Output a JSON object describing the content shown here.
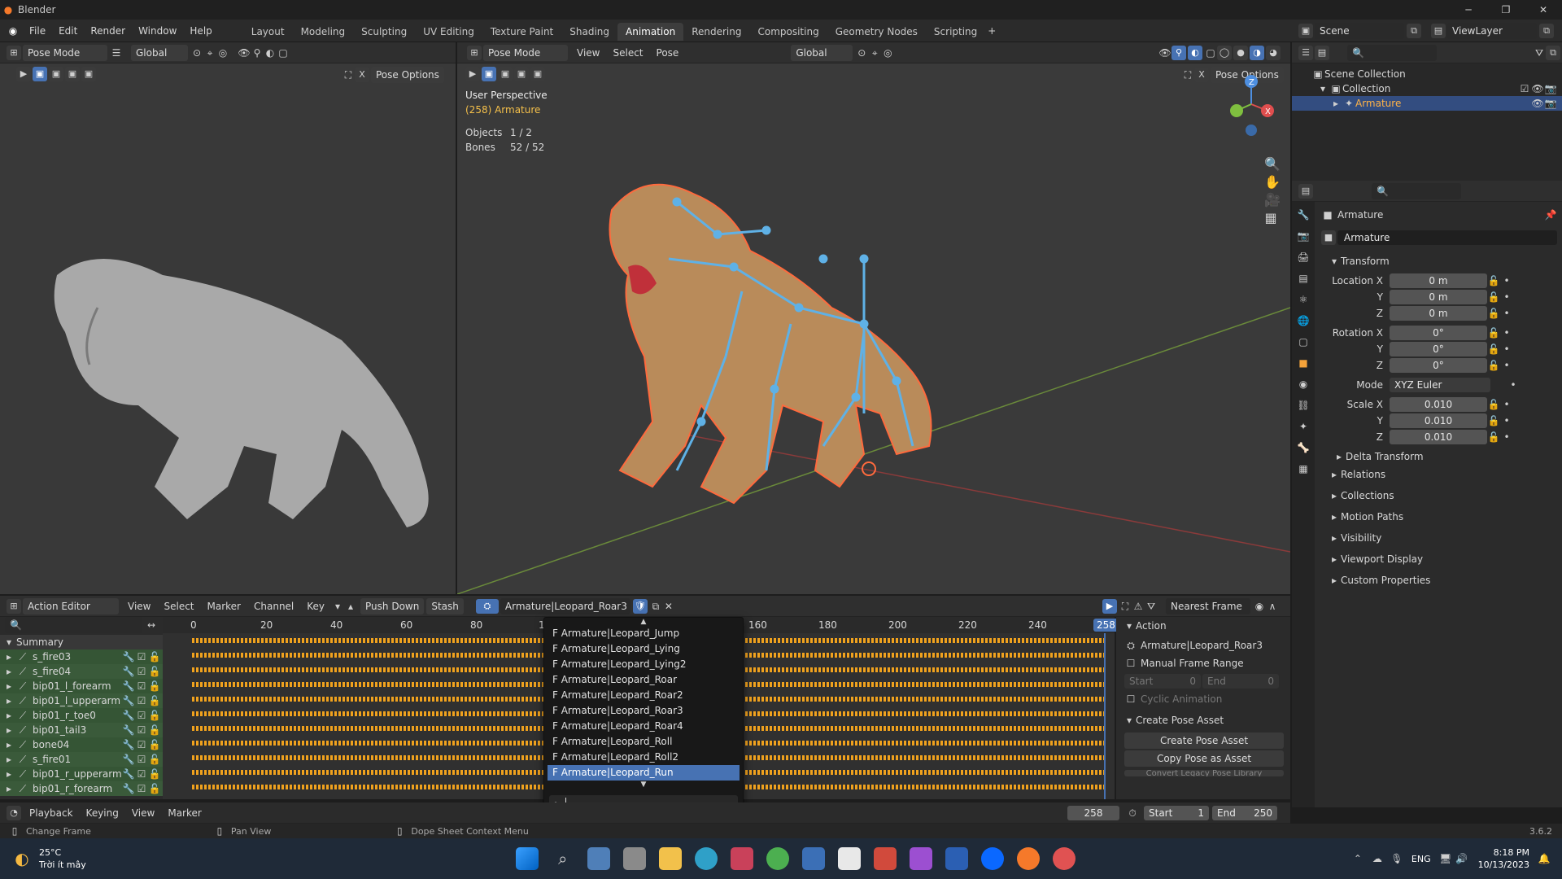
{
  "app": {
    "title": "Blender",
    "version": "3.6.2"
  },
  "menu": [
    "File",
    "Edit",
    "Render",
    "Window",
    "Help"
  ],
  "workspaces": [
    "Layout",
    "Modeling",
    "Sculpting",
    "UV Editing",
    "Texture Paint",
    "Shading",
    "Animation",
    "Rendering",
    "Compositing",
    "Geometry Nodes",
    "Scripting"
  ],
  "active_workspace": "Animation",
  "scene": {
    "name": "Scene",
    "view_layer": "ViewLayer"
  },
  "left_view": {
    "mode": "Pose Mode",
    "orientation": "Global",
    "pose_options": "Pose Options"
  },
  "main_view": {
    "mode": "Pose Mode",
    "menus": [
      "View",
      "Select",
      "Pose"
    ],
    "orientation": "Global",
    "pose_options": "Pose Options",
    "overlay": {
      "title": "User Perspective",
      "subtitle": "(258) Armature",
      "objects_label": "Objects",
      "objects_value": "1 / 2",
      "bones_label": "Bones",
      "bones_value": "52 / 52"
    },
    "gizmo": {
      "z": "Z",
      "x": "X",
      "y": "Y"
    }
  },
  "outliner": {
    "scene_collection": "Scene Collection",
    "collection": "Collection",
    "armature": "Armature"
  },
  "properties": {
    "object_name": "Armature",
    "data_name": "Armature",
    "transform_label": "Transform",
    "location_label": "Location X",
    "loc": [
      "0 m",
      "0 m",
      "0 m"
    ],
    "rotation_label": "Rotation X",
    "rot": [
      "0°",
      "0°",
      "0°"
    ],
    "mode_label": "Mode",
    "mode_value": "XYZ Euler",
    "scale_label": "Scale X",
    "scale": [
      "0.010",
      "0.010",
      "0.010"
    ],
    "axis_y": "Y",
    "axis_z": "Z",
    "sections": [
      "Delta Transform",
      "Relations",
      "Collections",
      "Motion Paths",
      "Visibility",
      "Viewport Display",
      "Custom Properties"
    ]
  },
  "action_editor": {
    "editor": "Action Editor",
    "menus": [
      "View",
      "Select",
      "Marker",
      "Channel",
      "Key"
    ],
    "push_down": "Push Down",
    "stash": "Stash",
    "action_name": "Armature|Leopard_Roar3",
    "snapping": "Nearest Frame",
    "ruler": [
      "0",
      "20",
      "40",
      "60",
      "80",
      "1",
      "160",
      "180",
      "200",
      "220",
      "240"
    ],
    "current_frame": "258",
    "summary": "Summary",
    "channels": [
      "s_fire03",
      "s_fire04",
      "bip01_l_forearm",
      "bip01_l_upperarm",
      "bip01_r_toe0",
      "bip01_tail3",
      "bone04",
      "s_fire01",
      "bip01_r_upperarm",
      "bip01_r_forearm"
    ],
    "dropdown": [
      "F Armature|Leopard_Jump",
      "F Armature|Leopard_Lying",
      "F Armature|Leopard_Lying2",
      "F Armature|Leopard_Roar",
      "F Armature|Leopard_Roar2",
      "F Armature|Leopard_Roar3",
      "F Armature|Leopard_Roar4",
      "F Armature|Leopard_Roll",
      "F Armature|Leopard_Roll2",
      "F Armature|Leopard_Run"
    ],
    "dropdown_selected": 9
  },
  "sidebar": {
    "action_label": "Action",
    "action_name": "Armature|Leopard_Roar3",
    "manual_range": "Manual Frame Range",
    "start_label": "Start",
    "start_value": "0",
    "end_label": "End",
    "end_value": "0",
    "cyclic": "Cyclic Animation",
    "create_pose_asset_hdr": "Create Pose Asset",
    "create_pose_asset_btn": "Create Pose Asset",
    "copy_pose_btn": "Copy Pose as Asset",
    "convert_btn": "Convert Legacy Pose Library"
  },
  "timeline": {
    "menus": [
      "Playback",
      "Keying",
      "View",
      "Marker"
    ],
    "frame": "258",
    "start_label": "Start",
    "start": "1",
    "end_label": "End",
    "end": "250"
  },
  "statusbar": {
    "change_frame": "Change Frame",
    "pan_view": "Pan View",
    "context_menu": "Dope Sheet Context Menu"
  },
  "taskbar": {
    "temp": "25°C",
    "weather": "Trời ít mây",
    "lang": "ENG",
    "time": "8:18 PM",
    "date": "10/13/2023"
  },
  "colors": {
    "accent": "#4772b3",
    "keyframe": "#f0a21e",
    "bone": "#5fb1e6",
    "selection": "#ff6a3d"
  }
}
